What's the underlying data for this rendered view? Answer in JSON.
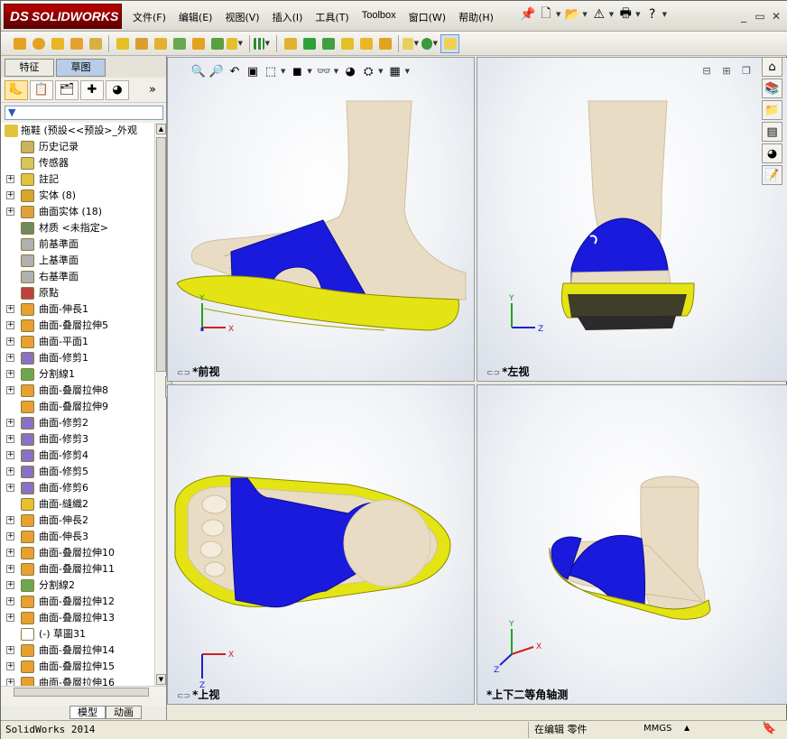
{
  "app": {
    "brand": "SOLIDWORKS",
    "brand_mark": "DS"
  },
  "menus": [
    "文件(F)",
    "编辑(E)",
    "视图(V)",
    "插入(I)",
    "工具(T)",
    "Toolbox",
    "窗口(W)",
    "帮助(H)"
  ],
  "panel": {
    "tabs": [
      "特征",
      "草图"
    ],
    "active_tab": "草图",
    "root_label": "拖鞋   (预設<<预設>_外观",
    "tree": [
      {
        "label": "历史记录",
        "icon": "history-icon",
        "expand": false,
        "color": "#c9b35e"
      },
      {
        "label": "传感器",
        "icon": "sensor-icon",
        "expand": false,
        "color": "#d9c45c"
      },
      {
        "label": "註記",
        "icon": "annotation-icon",
        "expand": true,
        "color": "#e2c33c"
      },
      {
        "label": "实体 (8)",
        "icon": "solid-bodies-icon",
        "expand": true,
        "color": "#d8a42a"
      },
      {
        "label": "曲面实体 (18)",
        "icon": "surface-bodies-icon",
        "expand": true,
        "color": "#e0a23a"
      },
      {
        "label": "材质 <未指定>",
        "icon": "material-icon",
        "expand": false,
        "color": "#6f8a5c"
      },
      {
        "label": "前基準面",
        "icon": "plane-icon",
        "expand": false,
        "color": "#b0b0b0"
      },
      {
        "label": "上基準面",
        "icon": "plane-icon",
        "expand": false,
        "color": "#b0b0b0"
      },
      {
        "label": "右基準面",
        "icon": "plane-icon",
        "expand": false,
        "color": "#b0b0b0"
      },
      {
        "label": "原點",
        "icon": "origin-icon",
        "expand": false,
        "color": "#c04040"
      },
      {
        "label": "曲面-伸長1",
        "icon": "surface-extrude-icon",
        "expand": true,
        "color": "#e8a030"
      },
      {
        "label": "曲面-叠層拉伸5",
        "icon": "surface-loft-icon",
        "expand": true,
        "color": "#e8a030"
      },
      {
        "label": "曲面-平面1",
        "icon": "planar-surface-icon",
        "expand": true,
        "color": "#e8a030"
      },
      {
        "label": "曲面-修剪1",
        "icon": "surface-trim-icon",
        "expand": true,
        "color": "#8a70c8"
      },
      {
        "label": "分割線1",
        "icon": "split-line-icon",
        "expand": true,
        "color": "#6aa84f"
      },
      {
        "label": "曲面-叠層拉伸8",
        "icon": "surface-loft-icon",
        "expand": true,
        "color": "#e8a030"
      },
      {
        "label": "曲面-叠層拉伸9",
        "icon": "surface-loft-icon",
        "expand": false,
        "color": "#e8a030"
      },
      {
        "label": "曲面-修剪2",
        "icon": "surface-trim-icon",
        "expand": true,
        "color": "#8a70c8"
      },
      {
        "label": "曲面-修剪3",
        "icon": "surface-trim-icon",
        "expand": true,
        "color": "#8a70c8"
      },
      {
        "label": "曲面-修剪4",
        "icon": "surface-trim-icon",
        "expand": true,
        "color": "#8a70c8"
      },
      {
        "label": "曲面-修剪5",
        "icon": "surface-trim-icon",
        "expand": true,
        "color": "#8a70c8"
      },
      {
        "label": "曲面-修剪6",
        "icon": "surface-trim-icon",
        "expand": true,
        "color": "#8a70c8"
      },
      {
        "label": "曲面-縫織2",
        "icon": "surface-knit-icon",
        "expand": false,
        "color": "#e8c030"
      },
      {
        "label": "曲面-伸長2",
        "icon": "surface-extrude-icon",
        "expand": true,
        "color": "#e8a030"
      },
      {
        "label": "曲面-伸長3",
        "icon": "surface-extrude-icon",
        "expand": true,
        "color": "#e8a030"
      },
      {
        "label": "曲面-叠層拉伸10",
        "icon": "surface-loft-icon",
        "expand": true,
        "color": "#e8a030"
      },
      {
        "label": "曲面-叠層拉伸11",
        "icon": "surface-loft-icon",
        "expand": true,
        "color": "#e8a030"
      },
      {
        "label": "分割線2",
        "icon": "split-line-icon",
        "expand": true,
        "color": "#6aa84f"
      },
      {
        "label": "曲面-叠層拉伸12",
        "icon": "surface-loft-icon",
        "expand": true,
        "color": "#e8a030"
      },
      {
        "label": "曲面-叠層拉伸13",
        "icon": "surface-loft-icon",
        "expand": true,
        "color": "#e8a030"
      },
      {
        "label": "(-) 草圖31",
        "icon": "sketch-icon",
        "expand": false,
        "color": "#ffffff"
      },
      {
        "label": "曲面-叠層拉伸14",
        "icon": "surface-loft-icon",
        "expand": true,
        "color": "#e8a030"
      },
      {
        "label": "曲面-叠層拉伸15",
        "icon": "surface-loft-icon",
        "expand": true,
        "color": "#e8a030"
      },
      {
        "label": "曲面-叠層拉伸16",
        "icon": "surface-loft-icon",
        "expand": true,
        "color": "#e8a030"
      }
    ],
    "bottom_tabs": [
      "模型",
      "动画"
    ],
    "active_bottom_tab": "模型"
  },
  "viewports": {
    "front": "*前视",
    "left": "*左视",
    "top": "*上视",
    "iso": "*上下二等角轴测"
  },
  "axis": {
    "x": "X",
    "y": "Y",
    "z": "Z"
  },
  "status": {
    "app": "SolidWorks 2014",
    "mode": "在编辑 零件",
    "units": "MMGS"
  },
  "colors": {
    "strap": "#1a1adc",
    "sole": "#e4e414",
    "skin": "#e9dcc4",
    "tread": "#2b2b2b"
  }
}
